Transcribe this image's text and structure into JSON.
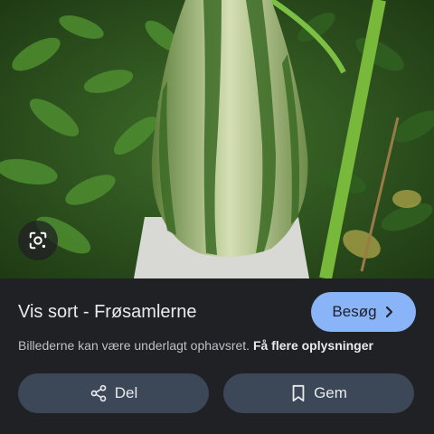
{
  "image": {
    "description_icon": "lens-icon"
  },
  "result": {
    "title": "Vis sort - Frøsamlerne",
    "visit_label": "Besøg",
    "visit_icon": "chevron-right-icon",
    "notice_text": "Billederne kan være underlagt ophavsret.",
    "notice_link": "Få flere oplysninger"
  },
  "actions": {
    "share_label": "Del",
    "share_icon": "share-icon",
    "save_label": "Gem",
    "save_icon": "bookmark-icon"
  },
  "colors": {
    "panel_bg": "#202124",
    "accent": "#8ab4f8",
    "secondary_button": "#3c4758"
  }
}
